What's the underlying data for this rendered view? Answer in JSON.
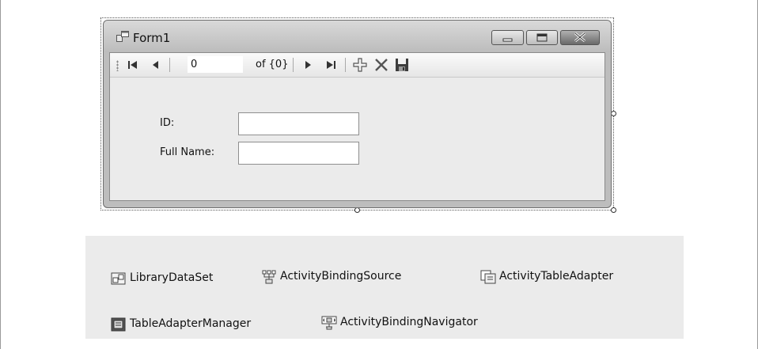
{
  "form": {
    "title": "Form1",
    "navigator": {
      "position_value": "0",
      "count_label": "of {0}",
      "icons": [
        "move-first-icon",
        "move-previous-icon",
        "move-next-icon",
        "move-last-icon",
        "add-new-icon",
        "delete-icon",
        "save-icon"
      ]
    },
    "fields": [
      {
        "label": "ID:",
        "value": ""
      },
      {
        "label": "Full Name:",
        "value": ""
      }
    ]
  },
  "tray": {
    "items": [
      {
        "label": "LibraryDataSet",
        "icon": "dataset-icon"
      },
      {
        "label": "ActivityBindingSource",
        "icon": "binding-source-icon"
      },
      {
        "label": "ActivityTableAdapter",
        "icon": "table-adapter-icon"
      },
      {
        "label": "TableAdapterManager",
        "icon": "table-adapter-manager-icon"
      },
      {
        "label": "ActivityBindingNavigator",
        "icon": "binding-navigator-icon"
      }
    ]
  }
}
